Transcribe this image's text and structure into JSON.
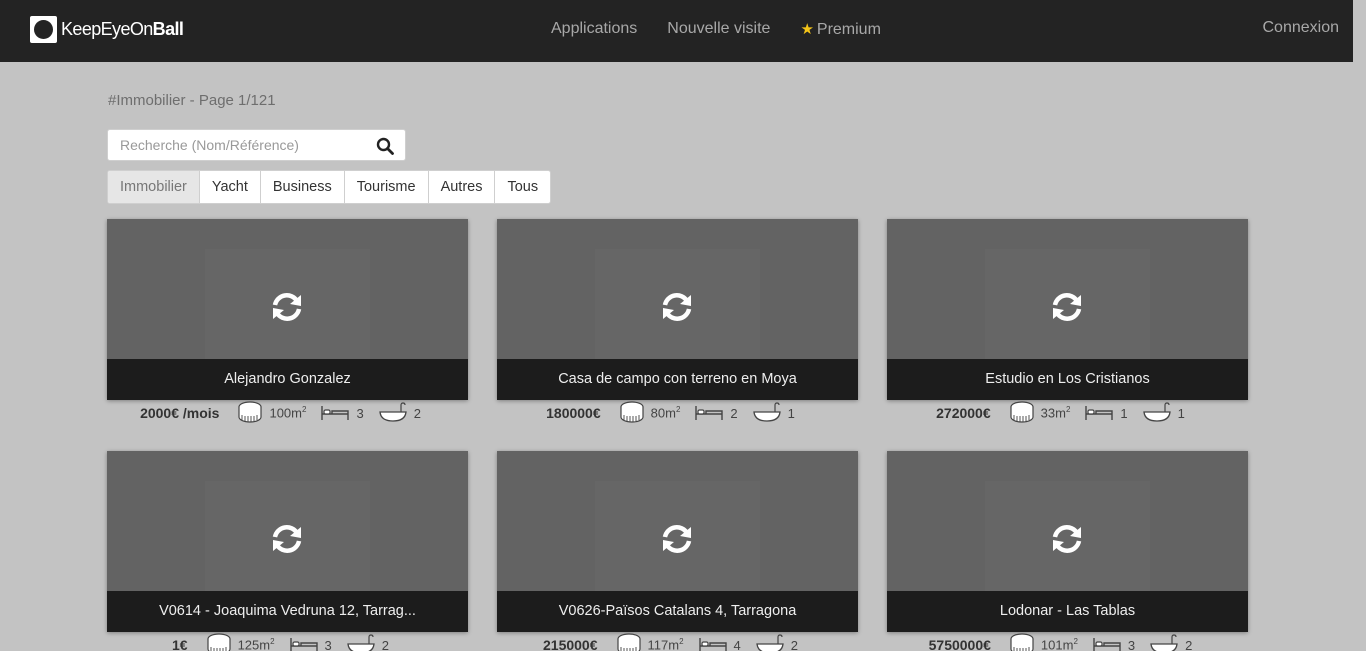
{
  "nav": {
    "brand_light": "KeepEyeOn",
    "brand_bold": "Ball",
    "links": [
      "Applications",
      "Nouvelle visite",
      "Premium"
    ],
    "login": "Connexion"
  },
  "page": {
    "title": "#Immobilier - Page 1/121",
    "search_placeholder": "Recherche (Nom/Référence)"
  },
  "tabs": [
    "Immobilier",
    "Yacht",
    "Business",
    "Tourisme",
    "Autres",
    "Tous"
  ],
  "active_tab": "Immobilier",
  "listings": [
    {
      "name": "Alejandro Gonzalez",
      "price": "2000€ /mois",
      "area": "100m",
      "beds": "3",
      "baths": "2"
    },
    {
      "name": "Casa de campo con terreno en Moya",
      "price": "180000€",
      "area": "80m",
      "beds": "2",
      "baths": "1"
    },
    {
      "name": "Estudio en Los Cristianos",
      "price": "272000€",
      "area": "33m",
      "beds": "1",
      "baths": "1"
    },
    {
      "name": "V0614 - Joaquima Vedruna 12, Tarrag...",
      "price": "1€",
      "area": "125m",
      "beds": "3",
      "baths": "2"
    },
    {
      "name": "V0626-Països Catalans 4, Tarragona",
      "price": "215000€",
      "area": "117m",
      "beds": "4",
      "baths": "2"
    },
    {
      "name": "Lodonar - Las Tablas",
      "price": "5750000€",
      "area": "101m",
      "beds": "3",
      "baths": "2"
    }
  ],
  "area_unit_sup": "2",
  "colors": {
    "navbar": "#232323",
    "background": "#c3c3c3",
    "star": "#f5c518"
  },
  "icons": [
    "search-icon",
    "refresh-icon",
    "tape-measure-icon",
    "bed-icon",
    "bathtub-icon",
    "star-icon"
  ]
}
